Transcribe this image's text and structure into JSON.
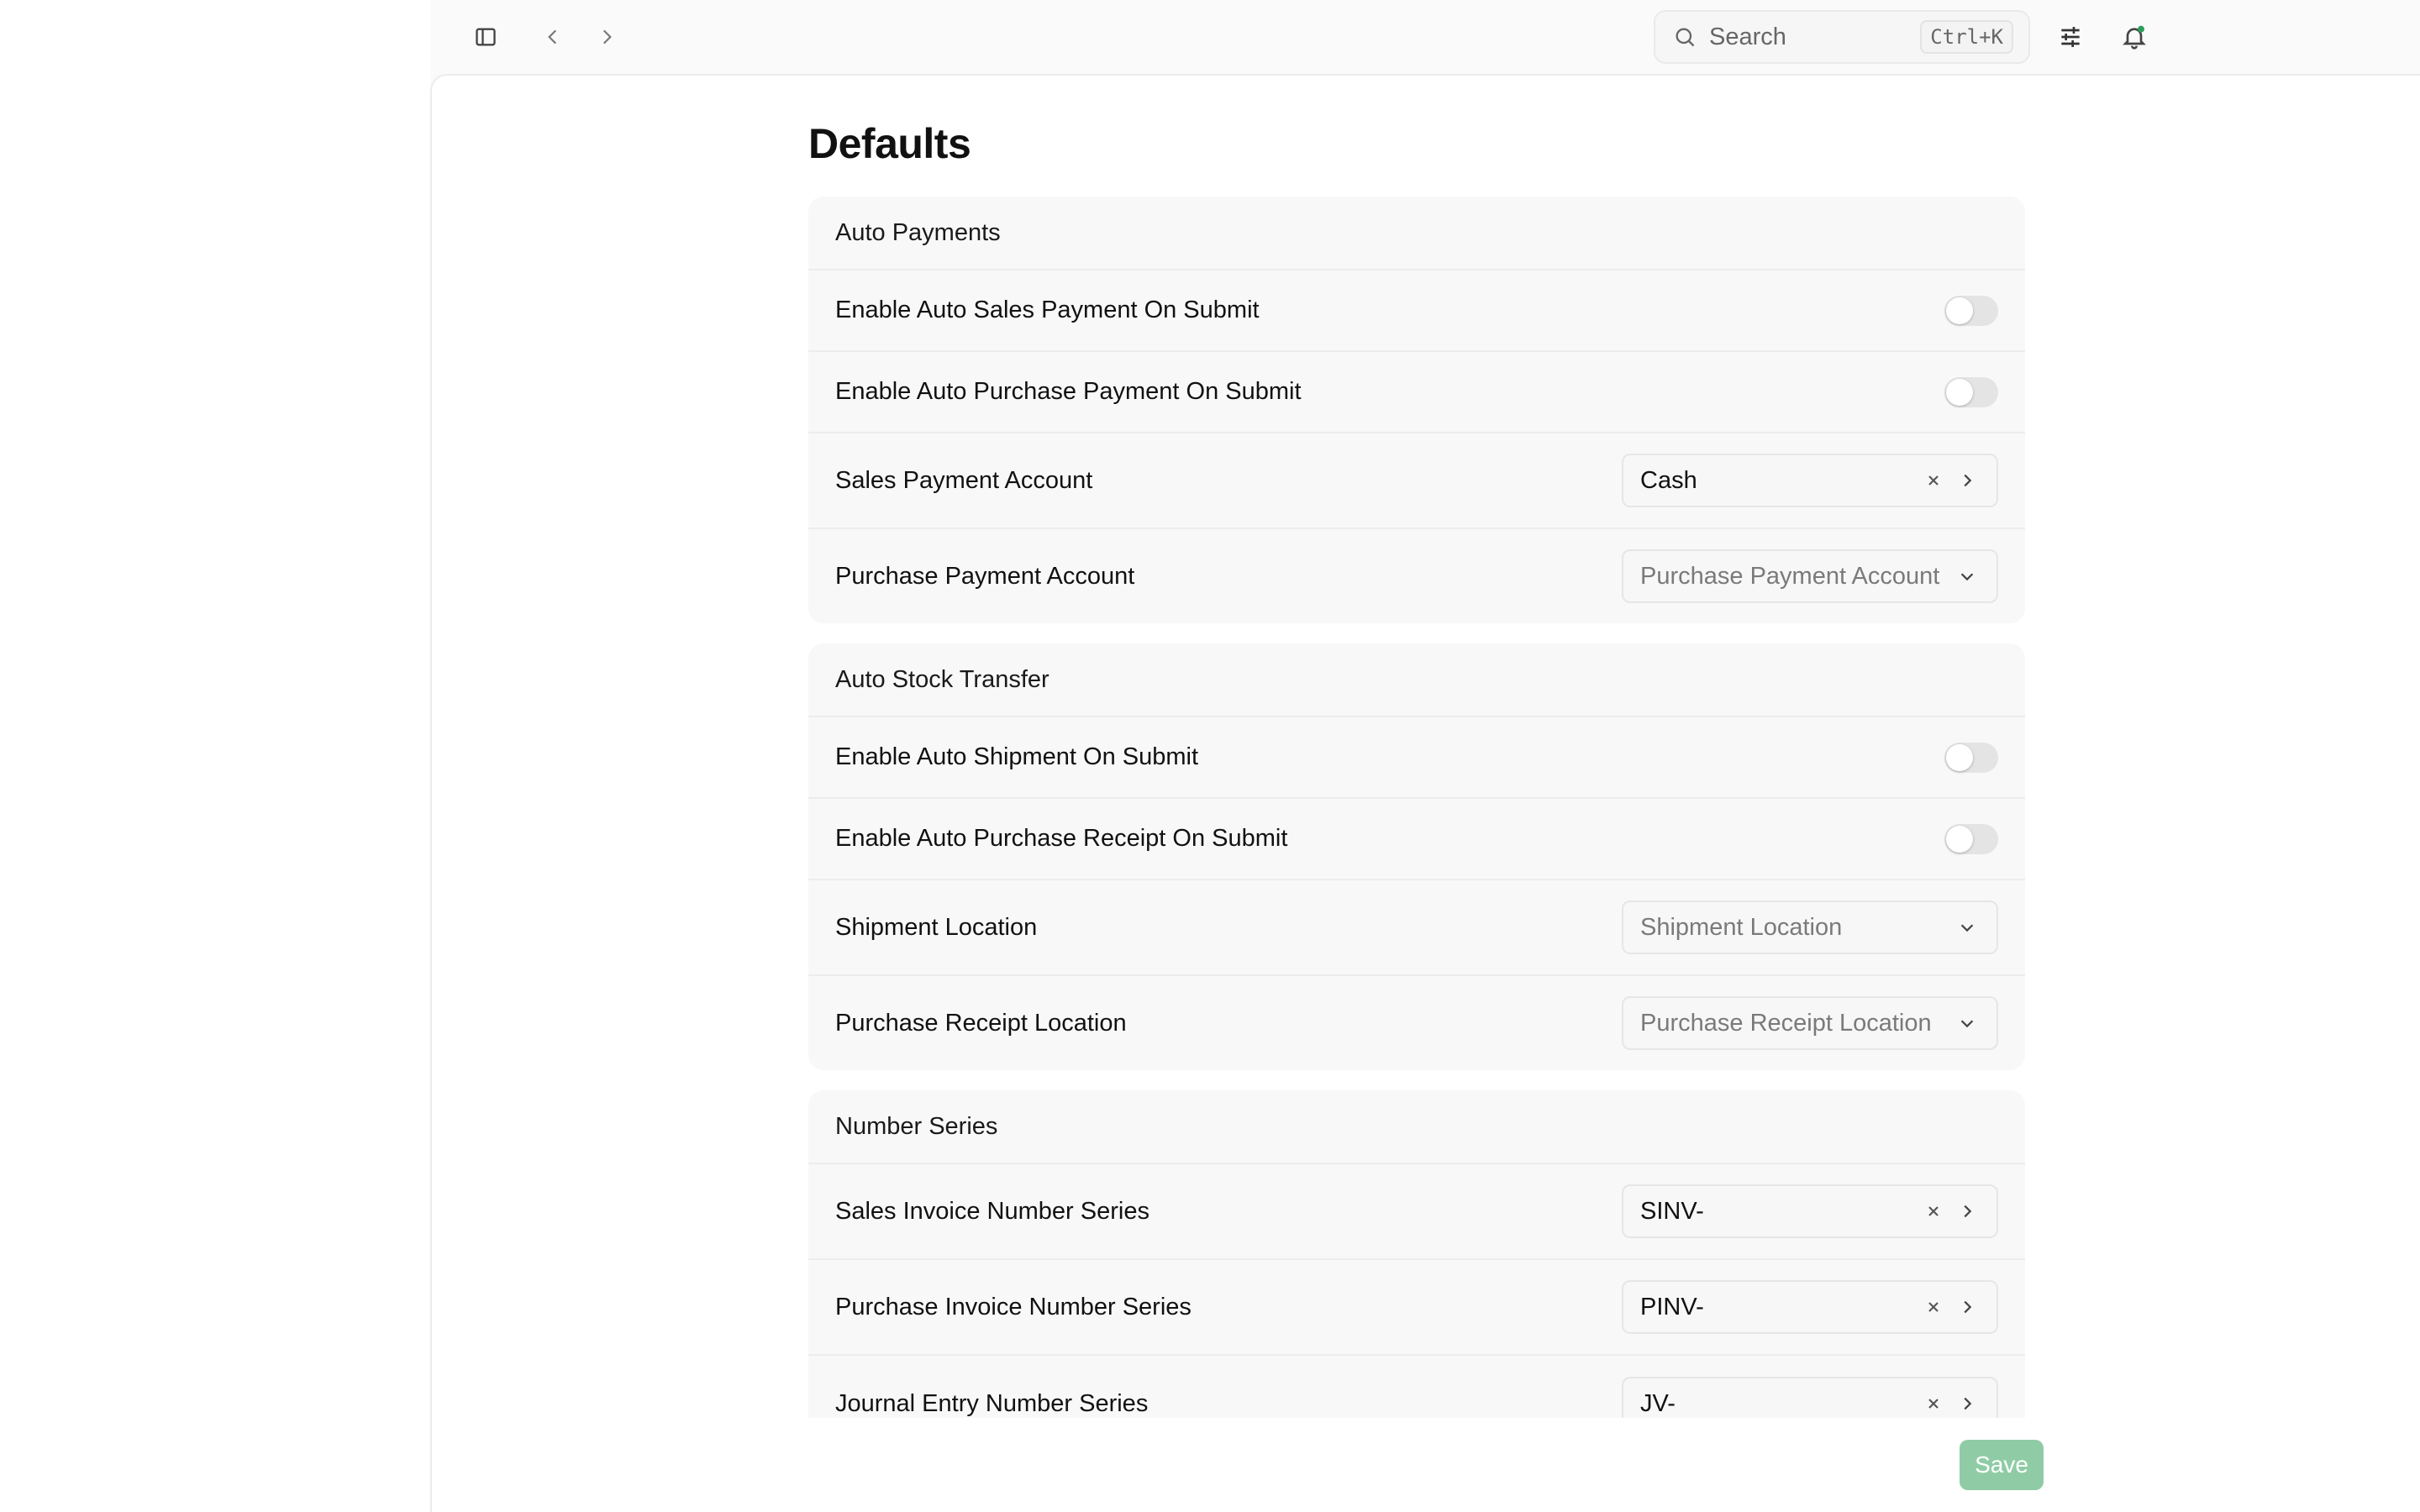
{
  "search": {
    "label": "Search",
    "shortcut": "Ctrl+K"
  },
  "page": {
    "title": "Defaults"
  },
  "sections": {
    "auto_payments": {
      "title": "Auto Payments",
      "enable_sales_payment": "Enable Auto Sales Payment On Submit",
      "enable_purchase_payment": "Enable Auto Purchase Payment On Submit",
      "sales_payment_account_label": "Sales Payment Account",
      "sales_payment_account_value": "Cash",
      "purchase_payment_account_label": "Purchase Payment Account",
      "purchase_payment_account_placeholder": "Purchase Payment Account"
    },
    "auto_stock_transfer": {
      "title": "Auto Stock Transfer",
      "enable_shipment": "Enable Auto Shipment On Submit",
      "enable_purchase_receipt": "Enable Auto Purchase Receipt On Submit",
      "shipment_location_label": "Shipment Location",
      "shipment_location_placeholder": "Shipment Location",
      "purchase_receipt_location_label": "Purchase Receipt Location",
      "purchase_receipt_location_placeholder": "Purchase Receipt Location"
    },
    "number_series": {
      "title": "Number Series",
      "sales_invoice_label": "Sales Invoice Number Series",
      "sales_invoice_value": "SINV-",
      "purchase_invoice_label": "Purchase Invoice Number Series",
      "purchase_invoice_value": "PINV-",
      "journal_entry_label": "Journal Entry Number Series",
      "journal_entry_value": "JV-"
    }
  },
  "toggles": {
    "enable_sales_payment": false,
    "enable_purchase_payment": false,
    "enable_shipment": false,
    "enable_purchase_receipt": false
  },
  "actions": {
    "save_label": "Save"
  },
  "colors": {
    "save_button": "#8fcca6",
    "notification_dot": "#2e9e5b"
  },
  "icons": [
    "sidebar-toggle-icon",
    "chevron-left-icon",
    "chevron-right-icon",
    "search-icon",
    "sliders-icon",
    "bell-icon",
    "clear-icon",
    "chevron-down-icon"
  ]
}
